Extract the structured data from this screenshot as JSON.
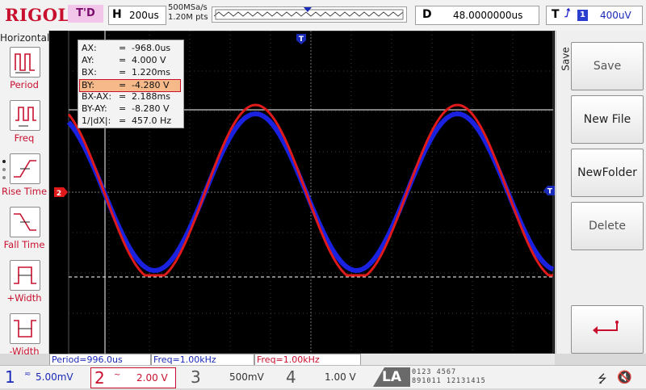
{
  "topbar": {
    "logo": "RIGOL",
    "trigger_state": "T'D",
    "horizontal_key": "H",
    "timebase": "200us",
    "sample_rate": "500MSa/s",
    "memory_depth": "1.20M pts",
    "delay_key": "D",
    "delay": "48.0000000us",
    "trigger_key": "T",
    "trigger_edge_icon": "rising-edge-icon",
    "trigger_source": "1",
    "trigger_level": "400uV"
  },
  "left_menu": {
    "title": "Horizontal",
    "items": [
      {
        "label": "Period",
        "icon": "period-icon"
      },
      {
        "label": "Freq",
        "icon": "freq-icon"
      },
      {
        "label": "Rise Time",
        "icon": "rise-time-icon"
      },
      {
        "label": "Fall Time",
        "icon": "fall-time-icon"
      },
      {
        "label": "+Width",
        "icon": "positive-width-icon"
      },
      {
        "label": "-Width",
        "icon": "negative-width-icon"
      }
    ]
  },
  "cursor_readout": {
    "rows": [
      {
        "name": "AX:",
        "eq": "=",
        "value": "-968.0us"
      },
      {
        "name": "AY:",
        "eq": "=",
        "value": "4.000 V"
      },
      {
        "name": "BX:",
        "eq": "=",
        "value": "1.220ms"
      },
      {
        "name": "BY:",
        "eq": "=",
        "value": "-4.280 V"
      },
      {
        "name": "BX-AX:",
        "eq": "=",
        "value": "2.188ms"
      },
      {
        "name": "BY-AY:",
        "eq": "=",
        "value": "-8.280 V"
      },
      {
        "name": "1/|dX|:",
        "eq": "=",
        "value": "457.0 Hz"
      }
    ]
  },
  "markers": {
    "ch2_marker": "2",
    "trigger_pos_marker": "T",
    "trigger_level_marker": "T"
  },
  "measurements": [
    {
      "text": "Period=996.0us",
      "color": "#1a2ab8"
    },
    {
      "text": "Freq=1.00kHz",
      "color": "#1a2ab8"
    },
    {
      "text": "Freq=1.00kHz",
      "color": "#c8102e"
    }
  ],
  "right_menu": {
    "title": "Save",
    "buttons": [
      "Save",
      "New File",
      "NewFolder",
      "Delete"
    ],
    "back_icon": "return-arrow-icon"
  },
  "channels": [
    {
      "num": "1",
      "coupling": "≂",
      "scale": "5.00mV",
      "color": "#1a2ab8"
    },
    {
      "num": "2",
      "coupling": "~",
      "scale": "2.00 V",
      "color": "#c8102e"
    },
    {
      "num": "3",
      "coupling": "",
      "scale": "500mV",
      "color": "#555555"
    },
    {
      "num": "4",
      "coupling": "",
      "scale": "1.00 V",
      "color": "#555555"
    }
  ],
  "la": {
    "label": "LA",
    "digits_row1": "0123 4567",
    "digits_row2": "891011 12131415"
  },
  "status_icons": {
    "usb": "usb-icon",
    "sound": "speaker-muted-icon"
  },
  "colors": {
    "ch1": "#1a2ab8",
    "ch2": "#e01a1a",
    "accent": "#c8102e"
  }
}
